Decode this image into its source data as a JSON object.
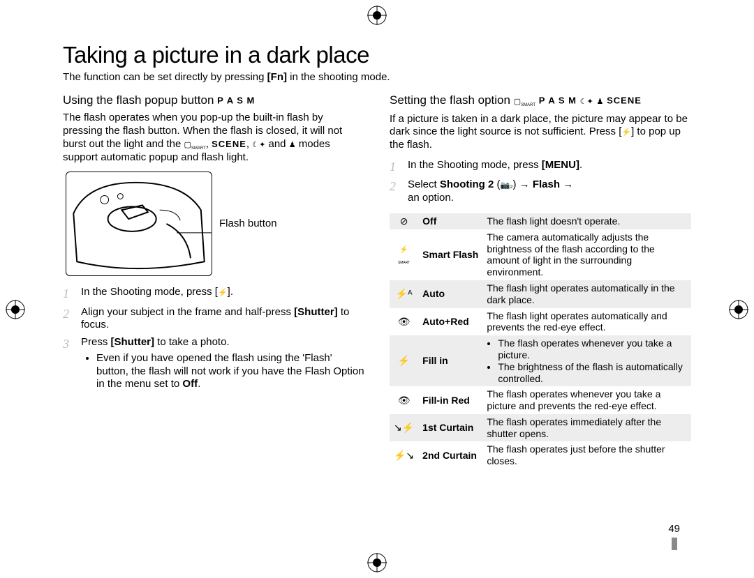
{
  "title": "Taking a picture in a dark place",
  "intro_a": "The function can be set directly by pressing ",
  "intro_fn": "[Fn]",
  "intro_b": " in the shooting mode.",
  "page_number": "49",
  "left": {
    "heading": "Using the flash popup button",
    "modes": "P A S M",
    "para_a": "The flash operates when you pop-up the built-in flash by pressing the flash button. When the flash is closed, it will not burst out the light and the ",
    "para_b": ", ",
    "scene": "SCENE",
    "para_c": ", ",
    "para_d": " and ",
    "para_e": " modes support automatic popup and flash light.",
    "diagram_label": "Flash button",
    "steps": {
      "s1_a": "In the Shooting mode, press [",
      "s1_b": "].",
      "s2_a": "Align your subject in the frame and half-press ",
      "s2_shutter": "[Shutter]",
      "s2_b": " to focus.",
      "s3_a": "Press ",
      "s3_shutter": "[Shutter]",
      "s3_b": " to take a photo.",
      "bullet_a": "Even if you have opened the flash using the 'Flash' button, the flash will not work if you have the Flash Option in the menu set to ",
      "bullet_off": "Off",
      "bullet_b": "."
    }
  },
  "right": {
    "heading": "Setting the flash option",
    "modes_smart": "SMART",
    "modes": "P A S M",
    "modes_scene": "SCENE",
    "para_a": "If a picture is taken in a dark place, the picture may appear to be dark since the light source is not sufficient. Press [",
    "para_b": "] to pop up the flash.",
    "steps": {
      "s1_a": "In the Shooting mode, press ",
      "s1_menu": "[MENU]",
      "s1_b": ".",
      "s2_a": "Select ",
      "s2_shooting": "Shooting 2",
      "s2_paren_open": " (",
      "s2_paren_close": ") ",
      "s2_arrow1": "→ ",
      "s2_flash": "Flash",
      "s2_arrow2": " →",
      "s2_b": "an option."
    },
    "table": [
      {
        "name": "Off",
        "desc": "The flash light doesn't operate."
      },
      {
        "name": "Smart Flash",
        "desc": "The camera automatically adjusts the brightness of the flash according to the amount of light in the surrounding environment."
      },
      {
        "name": "Auto",
        "desc": "The flash light operates automatically in the dark place."
      },
      {
        "name": "Auto+Red",
        "desc": "The flash light operates automatically and prevents the red-eye effect."
      },
      {
        "name": "Fill in",
        "desc_list": [
          "The flash operates whenever you take a picture.",
          "The brightness of the flash is automatically controlled."
        ]
      },
      {
        "name": "Fill-in Red",
        "desc": "The flash operates whenever you take a picture and prevents the red-eye effect."
      },
      {
        "name": "1st Curtain",
        "desc": "The flash operates immediately after the shutter opens."
      },
      {
        "name": "2nd Curtain",
        "desc": "The flash operates just before the shutter closes."
      }
    ]
  }
}
